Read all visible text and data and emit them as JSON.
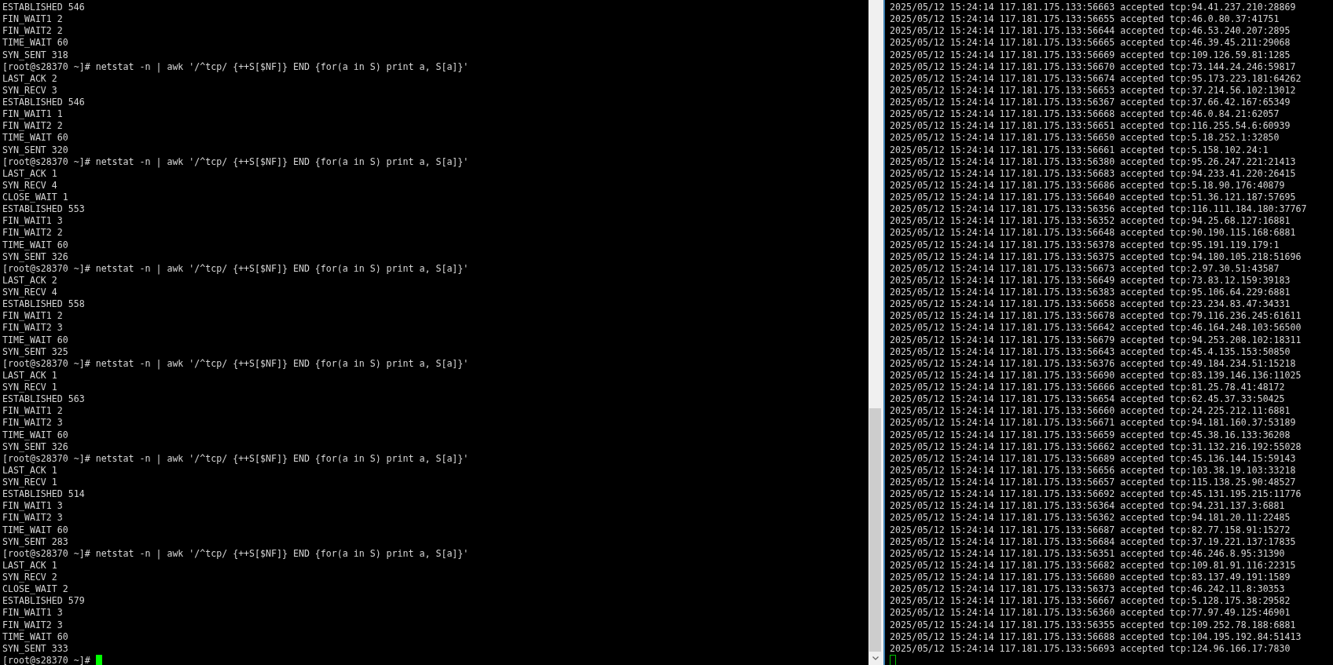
{
  "left_terminal": {
    "lines": [
      "ESTABLISHED 546",
      "FIN_WAIT1 2",
      "FIN_WAIT2 2",
      "TIME_WAIT 60",
      "SYN_SENT 318",
      "[root@s28370 ~]# netstat -n | awk '/^tcp/ {++S[$NF]} END {for(a in S) print a, S[a]}'",
      "LAST_ACK 2",
      "SYN_RECV 3",
      "ESTABLISHED 546",
      "FIN_WAIT1 1",
      "FIN_WAIT2 2",
      "TIME_WAIT 60",
      "SYN_SENT 320",
      "[root@s28370 ~]# netstat -n | awk '/^tcp/ {++S[$NF]} END {for(a in S) print a, S[a]}'",
      "LAST_ACK 1",
      "SYN_RECV 4",
      "CLOSE_WAIT 1",
      "ESTABLISHED 553",
      "FIN_WAIT1 3",
      "FIN_WAIT2 2",
      "TIME_WAIT 60",
      "SYN_SENT 326",
      "[root@s28370 ~]# netstat -n | awk '/^tcp/ {++S[$NF]} END {for(a in S) print a, S[a]}'",
      "LAST_ACK 2",
      "SYN_RECV 4",
      "ESTABLISHED 558",
      "FIN_WAIT1 2",
      "FIN_WAIT2 3",
      "TIME_WAIT 60",
      "SYN_SENT 325",
      "[root@s28370 ~]# netstat -n | awk '/^tcp/ {++S[$NF]} END {for(a in S) print a, S[a]}'",
      "LAST_ACK 1",
      "SYN_RECV 1",
      "ESTABLISHED 563",
      "FIN_WAIT1 2",
      "FIN_WAIT2 3",
      "TIME_WAIT 60",
      "SYN_SENT 326",
      "[root@s28370 ~]# netstat -n | awk '/^tcp/ {++S[$NF]} END {for(a in S) print a, S[a]}'",
      "LAST_ACK 1",
      "SYN_RECV 1",
      "ESTABLISHED 514",
      "FIN_WAIT1 3",
      "FIN_WAIT2 3",
      "TIME_WAIT 60",
      "SYN_SENT 283",
      "[root@s28370 ~]# netstat -n | awk '/^tcp/ {++S[$NF]} END {for(a in S) print a, S[a]}'",
      "LAST_ACK 1",
      "SYN_RECV 2",
      "CLOSE_WAIT 2",
      "ESTABLISHED 579",
      "FIN_WAIT1 3",
      "FIN_WAIT2 3",
      "TIME_WAIT 60",
      "SYN_SENT 333"
    ],
    "prompt": "[root@s28370 ~]#",
    "cursor": {
      "focused": true
    }
  },
  "right_terminal": {
    "lines": [
      "2025/05/12 15:24:14 117.181.175.133:56663 accepted tcp:94.41.237.210:28869",
      "2025/05/12 15:24:14 117.181.175.133:56655 accepted tcp:46.0.80.37:41751",
      "2025/05/12 15:24:14 117.181.175.133:56644 accepted tcp:46.53.240.207:2895",
      "2025/05/12 15:24:14 117.181.175.133:56665 accepted tcp:46.39.45.211:29068",
      "2025/05/12 15:24:14 117.181.175.133:56669 accepted tcp:109.126.59.81:1285",
      "2025/05/12 15:24:14 117.181.175.133:56670 accepted tcp:73.144.24.246:59817",
      "2025/05/12 15:24:14 117.181.175.133:56674 accepted tcp:95.173.223.181:64262",
      "2025/05/12 15:24:14 117.181.175.133:56653 accepted tcp:37.214.56.102:13012",
      "2025/05/12 15:24:14 117.181.175.133:56367 accepted tcp:37.66.42.167:65349",
      "2025/05/12 15:24:14 117.181.175.133:56668 accepted tcp:46.0.84.21:62057",
      "2025/05/12 15:24:14 117.181.175.133:56651 accepted tcp:116.255.54.6:60939",
      "2025/05/12 15:24:14 117.181.175.133:56650 accepted tcp:5.18.252.1:32850",
      "2025/05/12 15:24:14 117.181.175.133:56661 accepted tcp:5.158.102.24:1",
      "2025/05/12 15:24:14 117.181.175.133:56380 accepted tcp:95.26.247.221:21413",
      "2025/05/12 15:24:14 117.181.175.133:56683 accepted tcp:94.233.41.220:26415",
      "2025/05/12 15:24:14 117.181.175.133:56686 accepted tcp:5.18.90.176:40879",
      "2025/05/12 15:24:14 117.181.175.133:56640 accepted tcp:51.36.121.187:57695",
      "2025/05/12 15:24:14 117.181.175.133:56356 accepted tcp:116.111.184.180:37767",
      "2025/05/12 15:24:14 117.181.175.133:56352 accepted tcp:94.25.68.127:16881",
      "2025/05/12 15:24:14 117.181.175.133:56648 accepted tcp:90.190.115.168:6881",
      "2025/05/12 15:24:14 117.181.175.133:56378 accepted tcp:95.191.119.179:1",
      "2025/05/12 15:24:14 117.181.175.133:56375 accepted tcp:94.180.105.218:51696",
      "2025/05/12 15:24:14 117.181.175.133:56673 accepted tcp:2.97.30.51:43587",
      "2025/05/12 15:24:14 117.181.175.133:56649 accepted tcp:73.83.12.159:39183",
      "2025/05/12 15:24:14 117.181.175.133:56383 accepted tcp:95.106.64.229:6881",
      "2025/05/12 15:24:14 117.181.175.133:56658 accepted tcp:23.234.83.47:34331",
      "2025/05/12 15:24:14 117.181.175.133:56678 accepted tcp:79.116.236.245:61611",
      "2025/05/12 15:24:14 117.181.175.133:56642 accepted tcp:46.164.248.103:56500",
      "2025/05/12 15:24:14 117.181.175.133:56679 accepted tcp:94.253.208.102:18311",
      "2025/05/12 15:24:14 117.181.175.133:56643 accepted tcp:45.4.135.153:50850",
      "2025/05/12 15:24:14 117.181.175.133:56376 accepted tcp:49.184.234.51:15218",
      "2025/05/12 15:24:14 117.181.175.133:56690 accepted tcp:83.139.146.136:11025",
      "2025/05/12 15:24:14 117.181.175.133:56666 accepted tcp:81.25.78.41:48172",
      "2025/05/12 15:24:14 117.181.175.133:56654 accepted tcp:62.45.37.33:50425",
      "2025/05/12 15:24:14 117.181.175.133:56660 accepted tcp:24.225.212.11:6881",
      "2025/05/12 15:24:14 117.181.175.133:56671 accepted tcp:94.181.160.37:53189",
      "2025/05/12 15:24:14 117.181.175.133:56659 accepted tcp:45.38.16.133:36208",
      "2025/05/12 15:24:14 117.181.175.133:56662 accepted tcp:31.132.216.192:55028",
      "2025/05/12 15:24:14 117.181.175.133:56689 accepted tcp:45.136.144.15:59143",
      "2025/05/12 15:24:14 117.181.175.133:56656 accepted tcp:103.38.19.103:33218",
      "2025/05/12 15:24:14 117.181.175.133:56657 accepted tcp:115.138.25.90:48527",
      "2025/05/12 15:24:14 117.181.175.133:56692 accepted tcp:45.131.195.215:11776",
      "2025/05/12 15:24:14 117.181.175.133:56364 accepted tcp:94.231.137.3:6881",
      "2025/05/12 15:24:14 117.181.175.133:56362 accepted tcp:94.181.20.11:22485",
      "2025/05/12 15:24:14 117.181.175.133:56687 accepted tcp:82.77.158.91:15272",
      "2025/05/12 15:24:14 117.181.175.133:56684 accepted tcp:37.19.221.137:17835",
      "2025/05/12 15:24:14 117.181.175.133:56351 accepted tcp:46.246.8.95:31390",
      "2025/05/12 15:24:14 117.181.175.133:56682 accepted tcp:109.81.91.116:22315",
      "2025/05/12 15:24:14 117.181.175.133:56680 accepted tcp:83.137.49.191:1589",
      "2025/05/12 15:24:14 117.181.175.133:56373 accepted tcp:46.242.11.8:30353",
      "2025/05/12 15:24:14 117.181.175.133:56667 accepted tcp:5.128.175.38:29582",
      "2025/05/12 15:24:14 117.181.175.133:56360 accepted tcp:77.97.49.125:46901",
      "2025/05/12 15:24:14 117.181.175.133:56355 accepted tcp:109.252.78.188:6881",
      "2025/05/12 15:24:14 117.181.175.133:56688 accepted tcp:104.195.192.84:51413",
      "2025/05/12 15:24:14 117.181.175.133:56693 accepted tcp:124.96.166.17:7830"
    ],
    "cursor": {
      "focused": false
    }
  }
}
